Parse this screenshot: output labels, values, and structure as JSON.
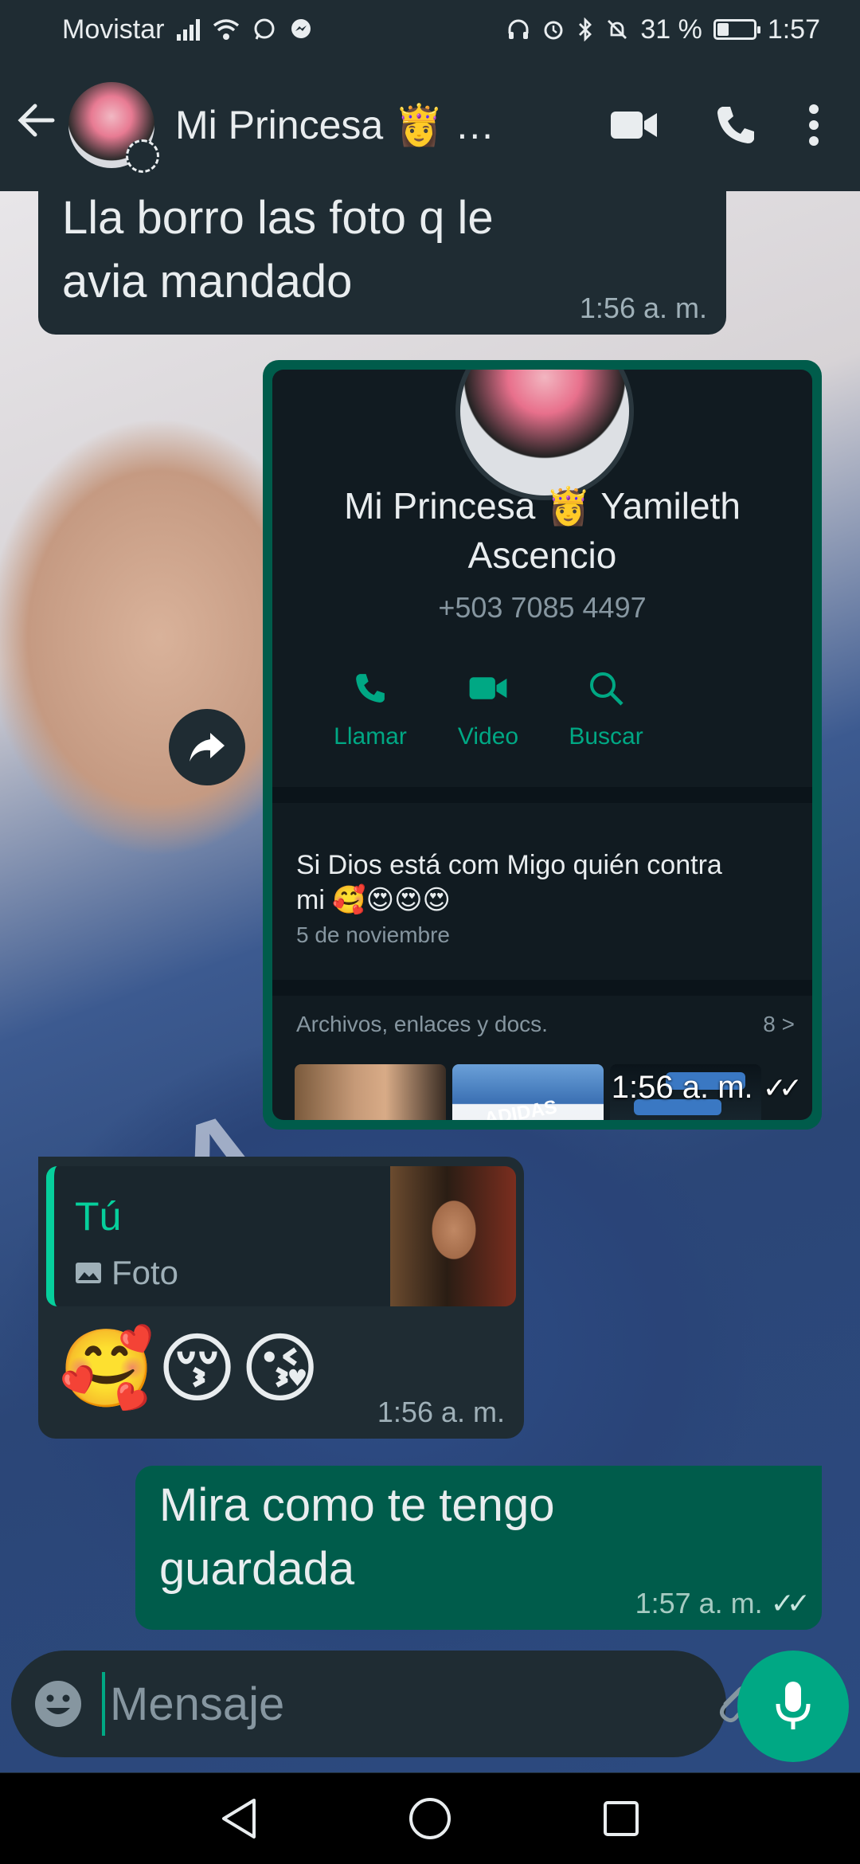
{
  "status_bar": {
    "carrier": "Movistar",
    "battery_text": "31 %",
    "battery_level": 0.31,
    "time": "1:57",
    "icons": [
      "signal-icon",
      "wifi-icon",
      "whatsapp-icon",
      "messenger-icon",
      "headphones-icon",
      "alarm-icon",
      "bluetooth-icon",
      "mute-icon",
      "battery-icon"
    ]
  },
  "header": {
    "contact_name": "Mi Princesa 👸 …",
    "icons": [
      "back-arrow-icon",
      "video-call-icon",
      "phone-icon",
      "more-vert-icon"
    ]
  },
  "messages": [
    {
      "id": "m1",
      "direction": "incoming",
      "text_line1": "Lla borro las foto q le",
      "text_line2": "avia mandado",
      "time": "1:56 a. m."
    },
    {
      "id": "m2",
      "direction": "outgoing",
      "kind": "image",
      "time": "1:56 a. m.",
      "ticks": "✓✓",
      "screenshot": {
        "name_line1": "Mi Princesa 👸 Yamileth",
        "name_line2": "Ascencio",
        "phone": "+503 7085 4497",
        "actions": [
          "Llamar",
          "Video",
          "Buscar"
        ],
        "about_line1": "Si Dios está com Migo quién contra",
        "about_line2": "mi 🥰😍😍😍",
        "about_date": "5 de noviembre",
        "files_label": "Archivos, enlaces y docs.",
        "files_count": "8 >",
        "thumb_text": "ADIDAS"
      }
    },
    {
      "id": "m3",
      "direction": "incoming",
      "reply_author": "Tú",
      "reply_type": "Foto",
      "text": "🥰😚😘",
      "time": "1:56 a. m."
    },
    {
      "id": "m4",
      "direction": "outgoing",
      "text_line1": "Mira como te tengo",
      "text_line2": "guardada",
      "time": "1:57 a. m.",
      "ticks": "✓✓"
    }
  ],
  "input": {
    "placeholder": "Mensaje"
  },
  "colors": {
    "bar_bg": "#1f2c33",
    "outgoing_bubble": "#005c4b",
    "incoming_bubble": "#1f2c33",
    "accent": "#00a884"
  }
}
